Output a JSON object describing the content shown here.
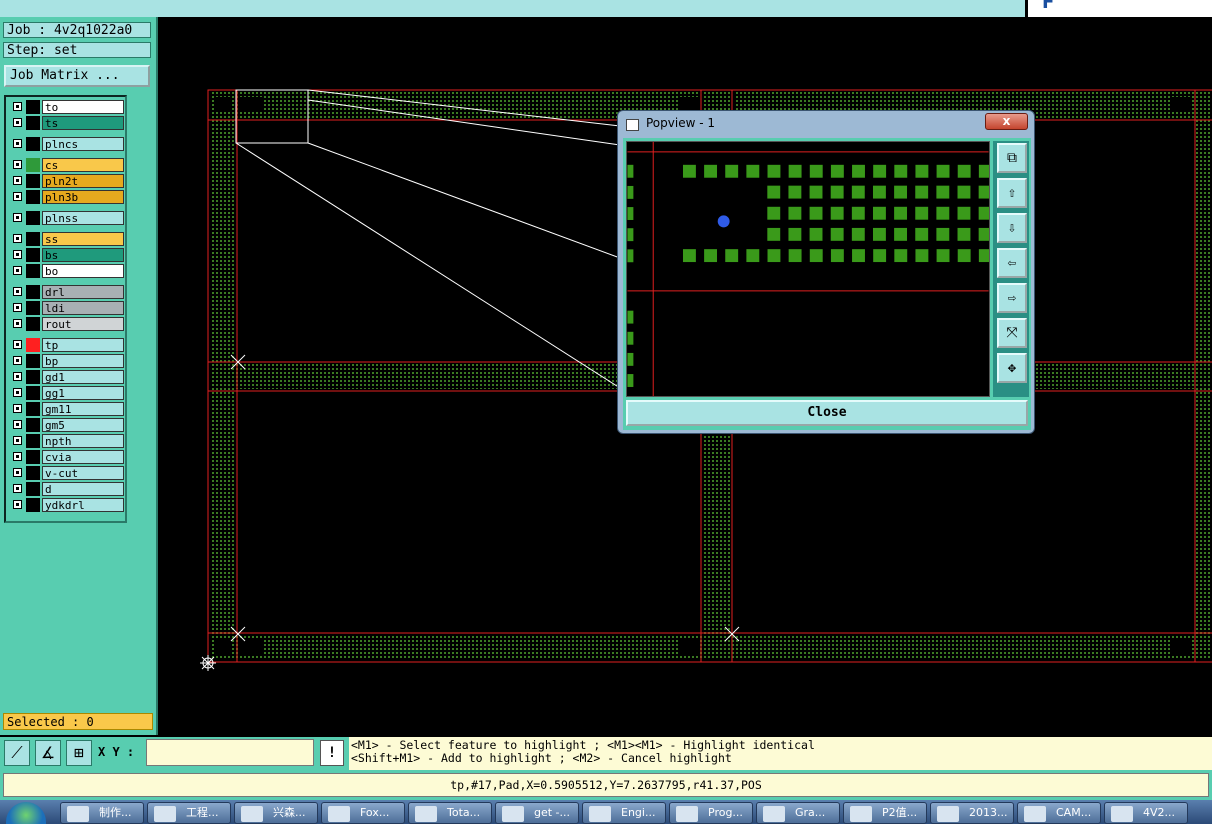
{
  "header": {
    "logo_text": "F"
  },
  "job": {
    "job_label": "Job : 4v2q1022a0",
    "step_label": "Step: set",
    "matrix_button": "Job Matrix ..."
  },
  "layers": [
    {
      "name": "to",
      "color": "#ffffff",
      "swatch": "#000000"
    },
    {
      "name": "ts",
      "color": "#1f9a7c",
      "swatch": "#000000"
    },
    {
      "name": "plncs",
      "color": "#a9e3e3",
      "swatch": "#000000"
    },
    {
      "name": "cs",
      "color": "#f9c84a",
      "swatch": "#2f9a3a"
    },
    {
      "name": "pln2t",
      "color": "#e6a91e",
      "swatch": "#000000"
    },
    {
      "name": "pln3b",
      "color": "#e6a91e",
      "swatch": "#000000"
    },
    {
      "name": "plnss",
      "color": "#a9e3e3",
      "swatch": "#000000"
    },
    {
      "name": "ss",
      "color": "#f9c84a",
      "swatch": "#000000"
    },
    {
      "name": "bs",
      "color": "#1f9a7c",
      "swatch": "#000000"
    },
    {
      "name": "bo",
      "color": "#ffffff",
      "swatch": "#000000"
    },
    {
      "name": "drl",
      "color": "#a8b0b4",
      "swatch": "#000000"
    },
    {
      "name": "ldi",
      "color": "#a8b0b4",
      "swatch": "#000000"
    },
    {
      "name": "rout",
      "color": "#d0d4d6",
      "swatch": "#000000"
    },
    {
      "name": "tp",
      "color": "#a9e3e3",
      "swatch": "#ff2020"
    },
    {
      "name": "bp",
      "color": "#a9e3e3",
      "swatch": "#000000"
    },
    {
      "name": "gd1",
      "color": "#a9e3e3",
      "swatch": "#000000"
    },
    {
      "name": "gg1",
      "color": "#a9e3e3",
      "swatch": "#000000"
    },
    {
      "name": "gm11",
      "color": "#a9e3e3",
      "swatch": "#000000"
    },
    {
      "name": "gm5",
      "color": "#a9e3e3",
      "swatch": "#000000"
    },
    {
      "name": "npth",
      "color": "#a9e3e3",
      "swatch": "#000000"
    },
    {
      "name": "cvia",
      "color": "#a9e3e3",
      "swatch": "#000000"
    },
    {
      "name": "v-cut",
      "color": "#a9e3e3",
      "swatch": "#000000"
    },
    {
      "name": "d",
      "color": "#a9e3e3",
      "swatch": "#000000"
    },
    {
      "name": "ydkdrl",
      "color": "#a9e3e3",
      "swatch": "#000000"
    }
  ],
  "selected_text": "Selected : 0",
  "toolbar": {
    "xy_label": "X Y :",
    "xy_value": "",
    "excl": "!"
  },
  "hints": {
    "line1": "<M1> - Select feature to highlight ; <M1><M1> - Highlight identical",
    "line2": "<Shift+M1> - Add to highlight ; <M2> - Cancel highlight"
  },
  "status": "tp,#17,Pad,X=0.5905512,Y=7.2637795,r41.37,POS",
  "popview": {
    "title": "Popview - 1",
    "close_x": "x",
    "close_button": "Close"
  },
  "taskbar": [
    "制作...",
    "工程...",
    "兴森...",
    "Fox...",
    "Tota...",
    "get -...",
    "Engi...",
    "Prog...",
    "Gra...",
    "P2值...",
    "2013...",
    "CAM...",
    "4V2..."
  ],
  "colors": {
    "panel": "#58cdb0",
    "light": "#a9e3e3",
    "pad": "#3a9a1a",
    "profile": "#e02020",
    "highlight": "#2f5be8"
  }
}
